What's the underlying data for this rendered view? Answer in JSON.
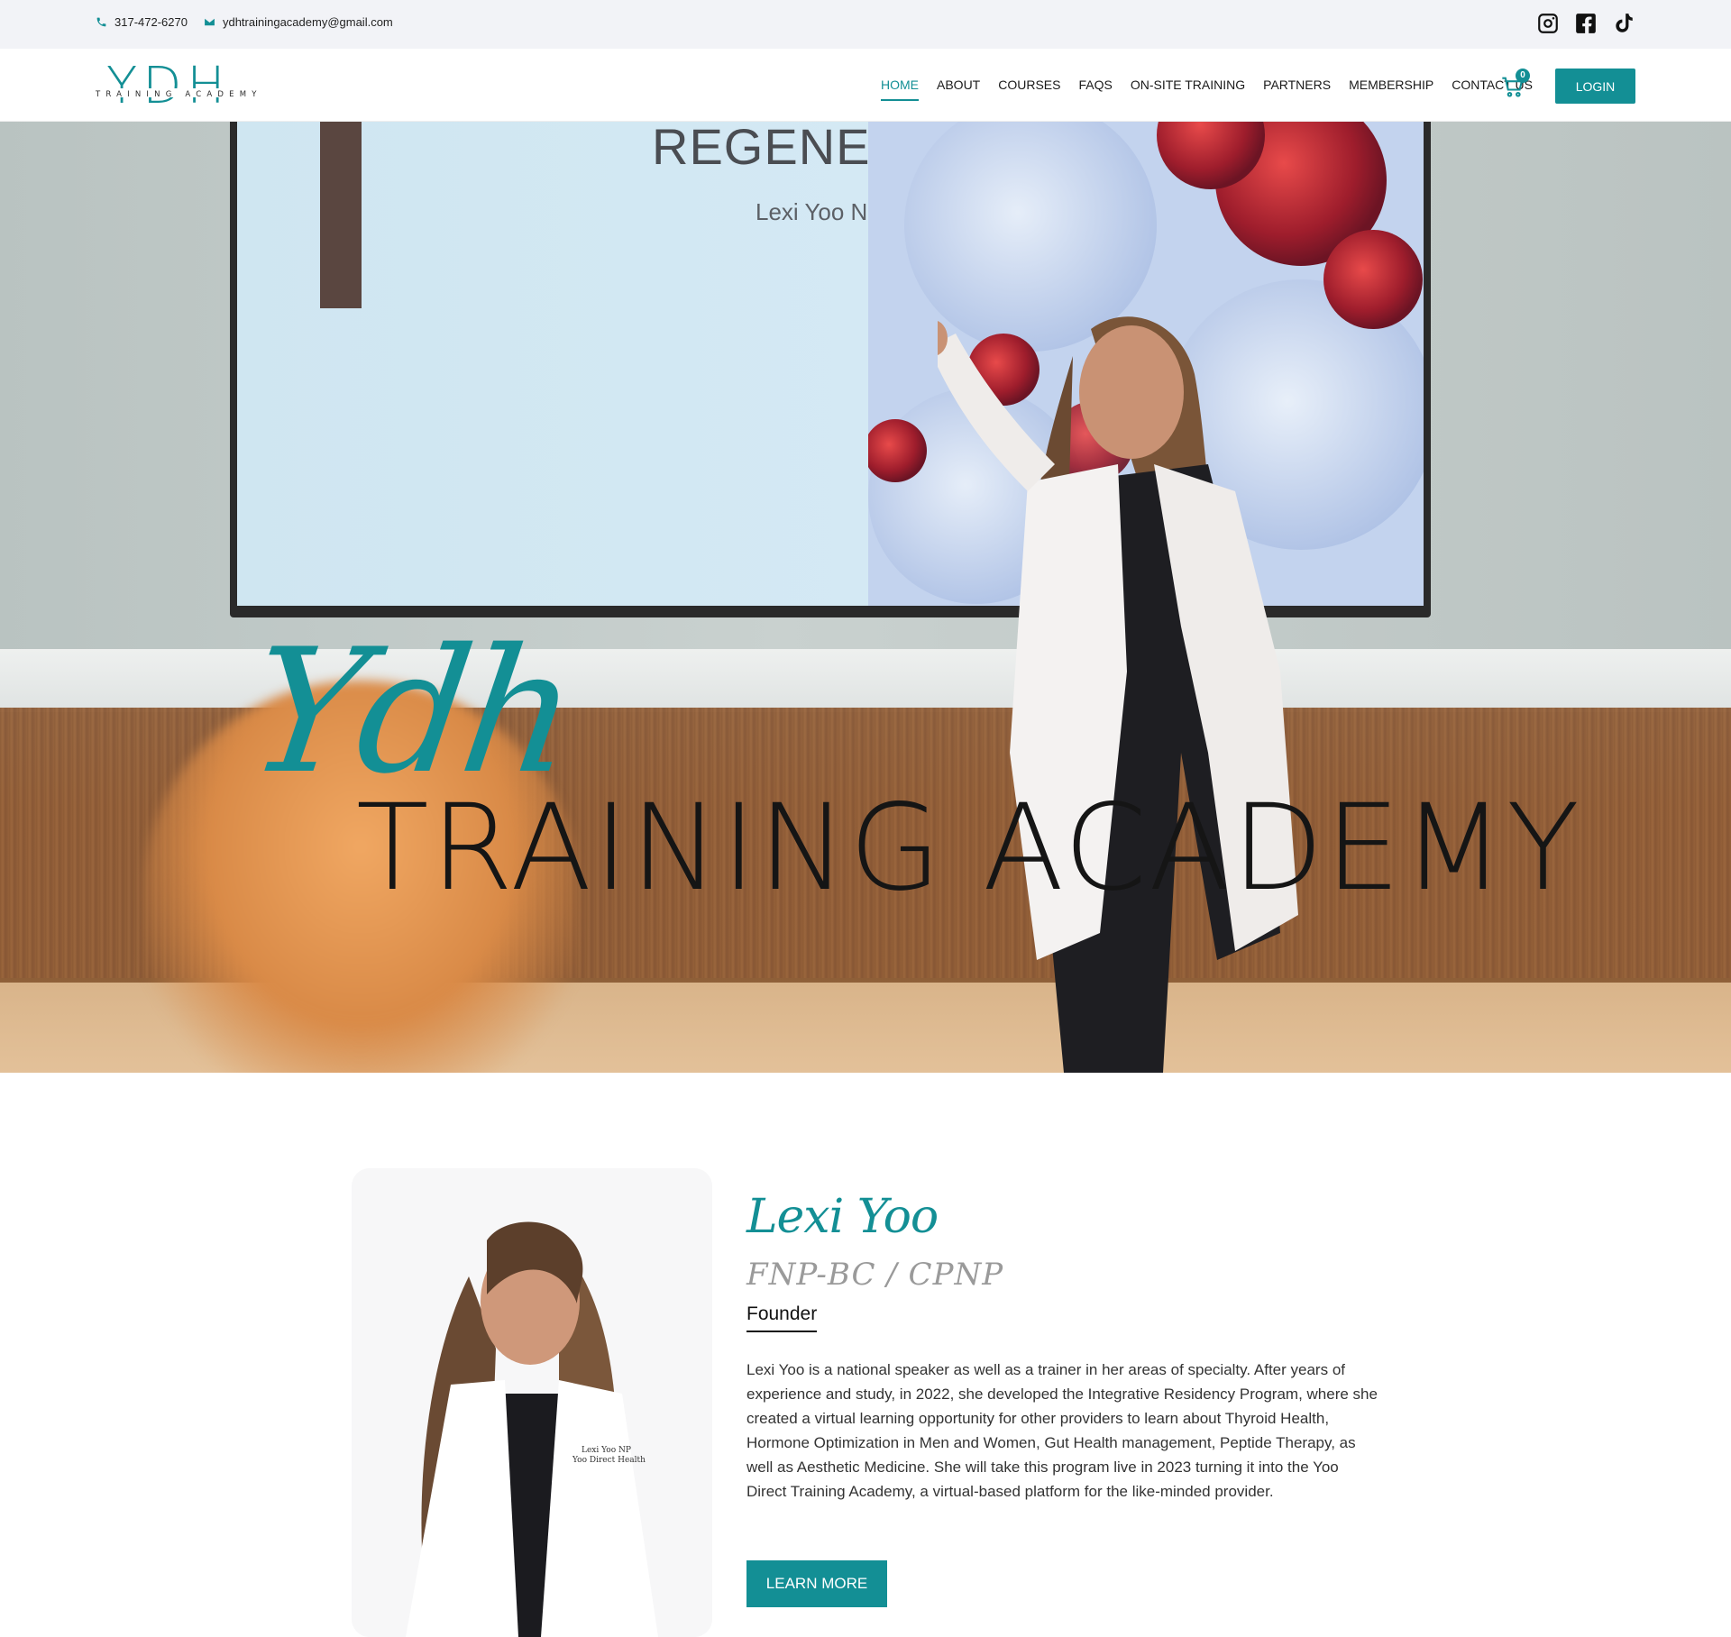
{
  "topbar": {
    "phone": "317-472-6270",
    "email": "ydhtrainingacademy@gmail.com",
    "social_icons": [
      "instagram-icon",
      "facebook-icon",
      "tiktok-icon"
    ]
  },
  "header": {
    "logo_text": "YDH",
    "logo_sub": "TRAINING ACADEMY",
    "nav": [
      {
        "label": "HOME",
        "active": true
      },
      {
        "label": "ABOUT"
      },
      {
        "label": "COURSES"
      },
      {
        "label": "FAQS"
      },
      {
        "label": "ON-SITE TRAINING"
      },
      {
        "label": "PARTNERS"
      },
      {
        "label": "MEMBERSHIP"
      },
      {
        "label": "CONTACT US"
      }
    ],
    "cart_count": "0",
    "login_label": "LOGIN"
  },
  "hero": {
    "screen_title": "REGENERATION",
    "screen_subtitle": "Lexi Yoo NP",
    "script_text": "Ydh",
    "title": "TRAINING ACADEMY"
  },
  "about": {
    "name": "Lexi Yoo",
    "credentials": "FNP-BC / CPNP",
    "role": "Founder",
    "bio": "Lexi Yoo is a national speaker as well as a trainer in her areas of specialty. After years of experience and study, in 2022, she developed the Integrative Residency Program, where she created a virtual learning opportunity for other providers to learn about Thyroid Health, Hormone Optimization in Men and Women, Gut Health management, Peptide Therapy, as well as Aesthetic Medicine. She will take this program live in 2023 turning it into the Yoo Direct Training Academy, a virtual-based platform for the like-minded provider.",
    "button_label": "LEARN MORE"
  },
  "colors": {
    "accent": "#138f95",
    "topbar_bg": "#f2f3f7",
    "text_dark": "#151515"
  }
}
